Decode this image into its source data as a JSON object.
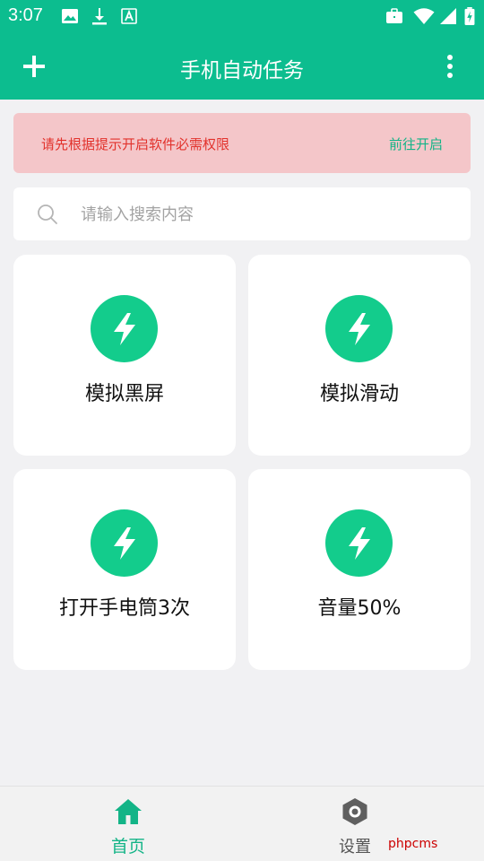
{
  "status_bar": {
    "time": "3:07",
    "left_icons": [
      "image-icon",
      "download-icon",
      "text-a-icon"
    ],
    "right_icons": [
      "briefcase-icon",
      "wifi-icon",
      "signal-icon",
      "battery-charging-icon"
    ]
  },
  "app_bar": {
    "title": "手机自动任务",
    "add_icon": "plus-icon",
    "menu_icon": "more-vert-icon",
    "color": "#0cbd8f"
  },
  "alert": {
    "message": "请先根据提示开启软件必需权限",
    "action": "前往开启",
    "bg_color": "#f4c6c9",
    "text_color": "#e2322c",
    "action_color": "#13b487"
  },
  "search": {
    "placeholder": "请输入搜索内容",
    "value": ""
  },
  "tasks": [
    {
      "label": "模拟黑屏",
      "icon": "lightning-icon"
    },
    {
      "label": "模拟滑动",
      "icon": "lightning-icon"
    },
    {
      "label": "打开手电筒3次",
      "icon": "lightning-icon"
    },
    {
      "label": "音量50%",
      "icon": "lightning-icon"
    }
  ],
  "bottom_nav": {
    "items": [
      {
        "label": "首页",
        "icon": "home-icon",
        "active": true
      },
      {
        "label": "设置",
        "icon": "settings-hexagon-icon",
        "active": false
      }
    ],
    "active_color": "#13b487"
  },
  "watermark": "phpcms"
}
